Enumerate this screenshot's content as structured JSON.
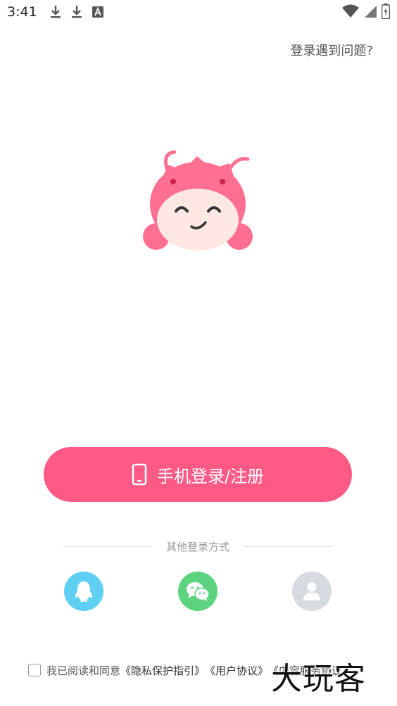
{
  "status_bar": {
    "time": "3:41",
    "left_icons": [
      "download-icon",
      "download-icon",
      "accessibility-icon"
    ],
    "right_icons": [
      "wifi-icon",
      "signal-icon",
      "battery-icon"
    ]
  },
  "help_link": "登录遇到问题?",
  "phone_login": {
    "icon": "phone-icon",
    "label": "手机登录/注册",
    "color": "#ff5a86"
  },
  "other_methods_label": "其他登录方式",
  "social": {
    "qq_color": "#5fd0f3",
    "wechat_color": "#5ed37f",
    "guest_color": "#d6dbe2"
  },
  "agreement": {
    "prefix": "我已阅读和同意",
    "privacy": "《隐私保护指引》",
    "user": "《用户协议》",
    "content": "《内容服务协议》"
  },
  "watermark": "大玩客"
}
